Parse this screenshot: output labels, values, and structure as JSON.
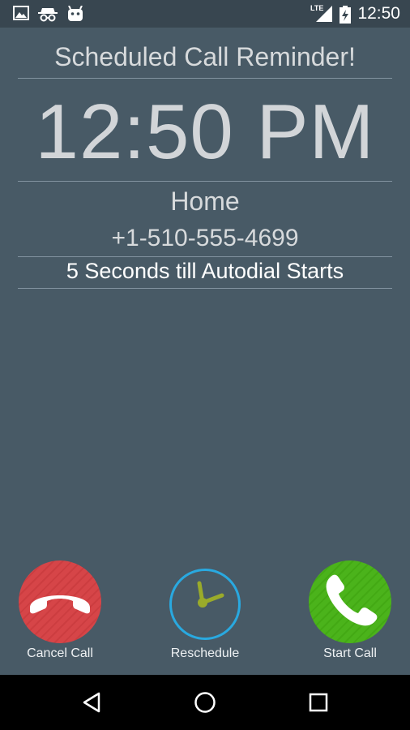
{
  "status_bar": {
    "icons": [
      "image-icon",
      "incognito-icon",
      "android-icon",
      "lte-signal-icon",
      "battery-charging-icon"
    ],
    "network": "LTE",
    "time": "12:50"
  },
  "reminder": {
    "title": "Scheduled Call Reminder!",
    "time": "12:50 PM",
    "contact_name": "Home",
    "contact_number": "+1-510-555-4699",
    "countdown": "5 Seconds till Autodial Starts"
  },
  "actions": {
    "cancel_label": "Cancel Call",
    "reschedule_label": "Reschedule",
    "start_label": "Start Call"
  },
  "colors": {
    "background": "#485a66",
    "cancel": "#d64548",
    "reschedule": "#29a9e0",
    "start": "#4bb31b"
  },
  "nav_bar": {
    "icons": [
      "back-icon",
      "home-icon",
      "recents-icon"
    ]
  }
}
